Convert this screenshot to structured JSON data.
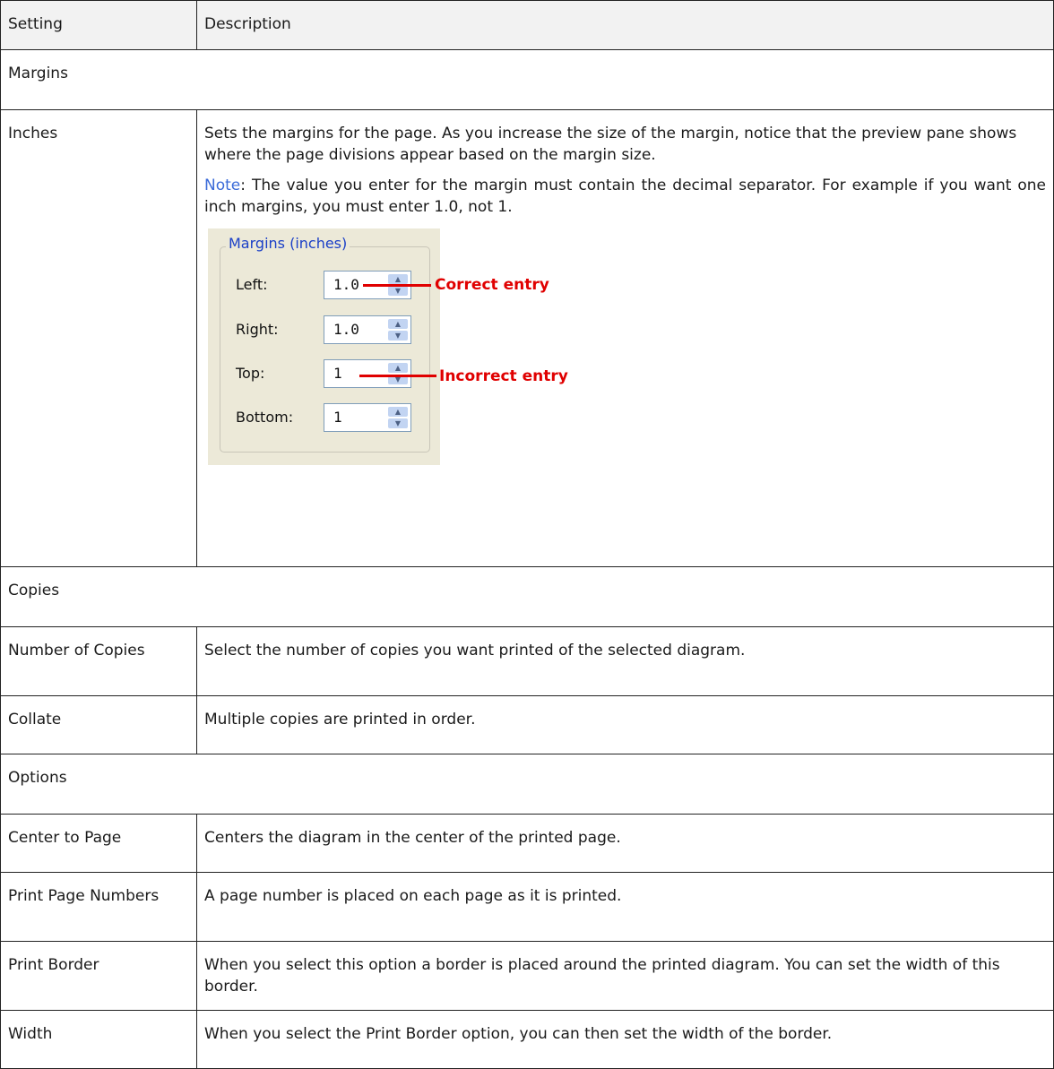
{
  "table": {
    "header": {
      "setting": "Setting",
      "description": "Description"
    },
    "sections": {
      "margins": "Margins",
      "copies": "Copies",
      "options": "Options"
    },
    "rows": {
      "inches": {
        "setting": "Inches",
        "description": "Sets the margins for the page. As you increase the size of the margin, notice that the preview pane shows where the page divisions appear based on the margin size.",
        "note_label": "Note",
        "note_text": ": The value you enter for the margin must contain the decimal separator. For example if you want one inch margins, you must enter 1.0, not 1."
      },
      "number_of_copies": {
        "setting": "Number of Copies",
        "description": "Select the number of copies you want printed of the selected diagram."
      },
      "collate": {
        "setting": "Collate",
        "description": "Multiple copies are printed in order."
      },
      "center_to_page": {
        "setting": "Center to Page",
        "description": "Centers the diagram in the center of the printed page."
      },
      "print_page_numbers": {
        "setting": "Print Page Numbers",
        "description": "A page number is placed on each page as it is printed."
      },
      "print_border": {
        "setting": "Print Border",
        "description": "When you select this option a border is placed around the printed diagram. You can set the width of this border."
      },
      "width": {
        "setting": "Width",
        "description": "When you select the Print Border option, you can then set the width of the border."
      }
    }
  },
  "figure": {
    "group_title": "Margins (inches)",
    "fields": [
      {
        "label": "Left:",
        "value": "1.0"
      },
      {
        "label": "Right:",
        "value": "1.0"
      },
      {
        "label": "Top:",
        "value": "1"
      },
      {
        "label": "Bottom:",
        "value": "1"
      }
    ],
    "annotations": {
      "correct": "Correct entry",
      "incorrect": "Incorrect entry"
    },
    "colors": {
      "annotation": "#e00000",
      "panel": "#ece9d8",
      "note": "#3a6ad8"
    }
  }
}
